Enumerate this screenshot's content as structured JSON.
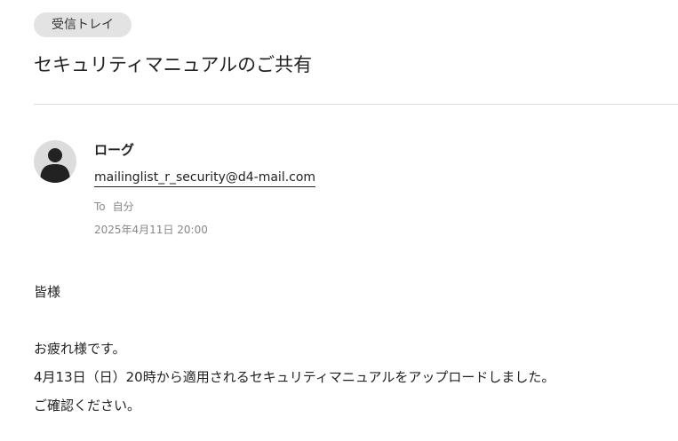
{
  "header": {
    "folder_label": "受信トレイ",
    "subject": "セキュリティマニュアルのご共有"
  },
  "message": {
    "sender_name": "ローグ",
    "sender_email": "mailinglist_r_security@d4-mail.com",
    "to_label": "To",
    "to_value": "自分",
    "date": "2025年4月11日 20:00",
    "body": {
      "greeting": "皆様",
      "blank": "",
      "line1": "お疲れ様です。",
      "line2": "4月13日（日）20時から適用されるセキュリティマニュアルをアップロードしました。",
      "line3": "ご確認ください。"
    }
  },
  "icons": {
    "avatar": "user-avatar-icon"
  },
  "colors": {
    "badge_background": "#e3e3e3",
    "divider": "#dcdcdc",
    "meta_text": "#888888",
    "text": "#222222",
    "avatar_background": "#dcdcdc",
    "avatar_figure": "#222222"
  }
}
